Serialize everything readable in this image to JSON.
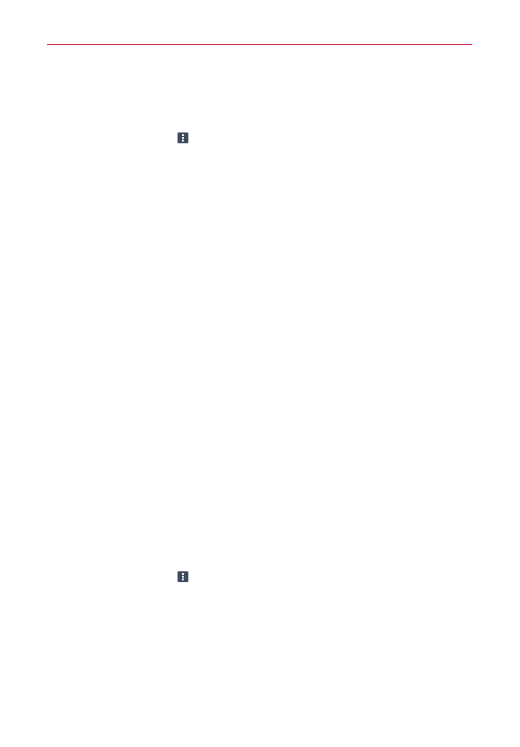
{
  "page": {
    "background_color": "#ffffff",
    "rule_color": "#c8102e",
    "icon_color": "#3c4a5c"
  },
  "icons": [
    {
      "name": "more-options-icon"
    },
    {
      "name": "more-options-icon"
    }
  ]
}
